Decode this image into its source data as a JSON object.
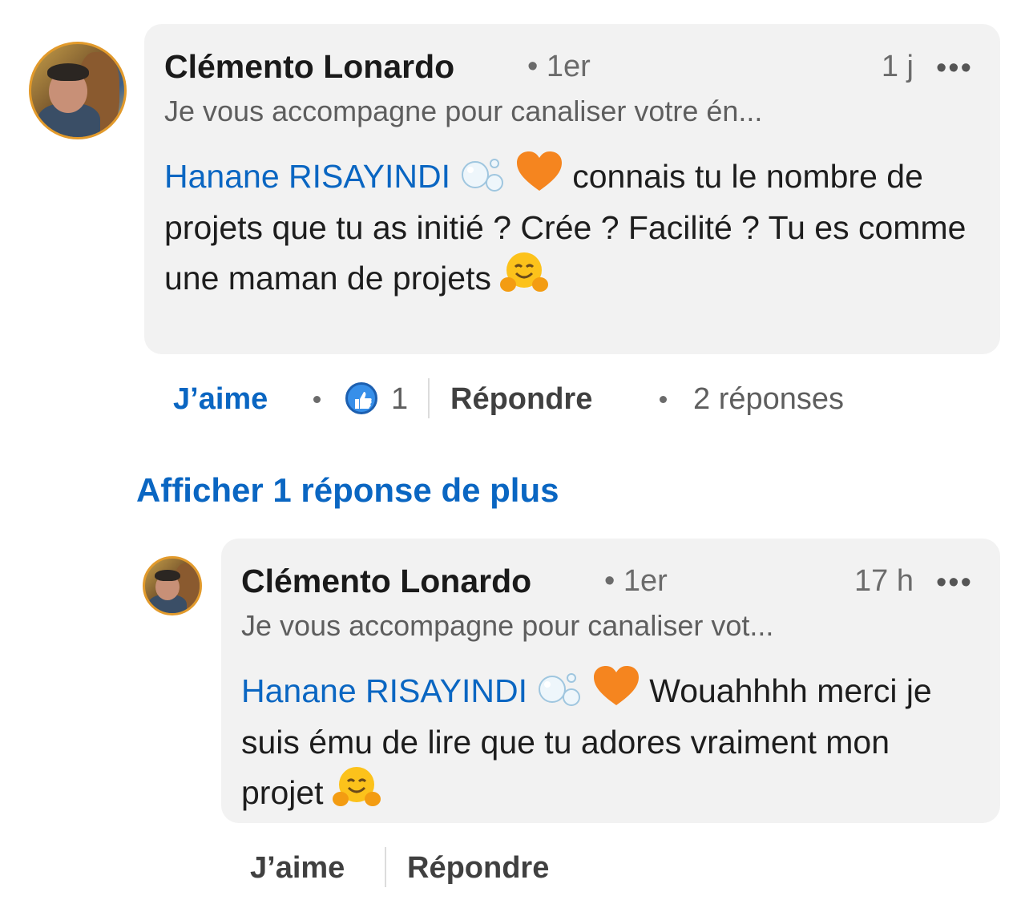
{
  "comment": {
    "author": "Clémento Lonardo",
    "degree": "• 1er",
    "time": "1 j",
    "more": "•••",
    "headline": "Je vous accompagne pour canaliser votre én...",
    "mention": "Hanane RISAYINDI",
    "text_line1": "connais tu le",
    "text_rest": "nombre de projets que tu as initié ? Crée ? Facilité ? Tu es comme une maman de projets",
    "actions": {
      "like": "J’aime",
      "like_count": "1",
      "reply": "Répondre",
      "replies": "2 réponses"
    }
  },
  "show_more": "Afficher 1 réponse de plus",
  "reply": {
    "author": "Clémento Lonardo",
    "degree": "• 1er",
    "time": "17 h",
    "more": "•••",
    "headline": "Je vous accompagne pour canaliser vot...",
    "mention": "Hanane RISAYINDI",
    "text_line1": "Wouahhhh",
    "text_rest": "merci je suis ému de lire que tu adores vraiment mon projet",
    "actions": {
      "like": "J’aime",
      "reply": "Répondre"
    }
  },
  "colors": {
    "link": "#0a66c2",
    "bubble": "#f2f2f2",
    "text": "#1d1d1d",
    "muted": "#6b6b6b"
  },
  "icons": {
    "like": "thumbs-up-icon",
    "more": "more-horizontal-icon",
    "bubbles": "bubbles-emoji",
    "heart": "orange-heart-emoji",
    "hug": "hugging-face-emoji"
  }
}
